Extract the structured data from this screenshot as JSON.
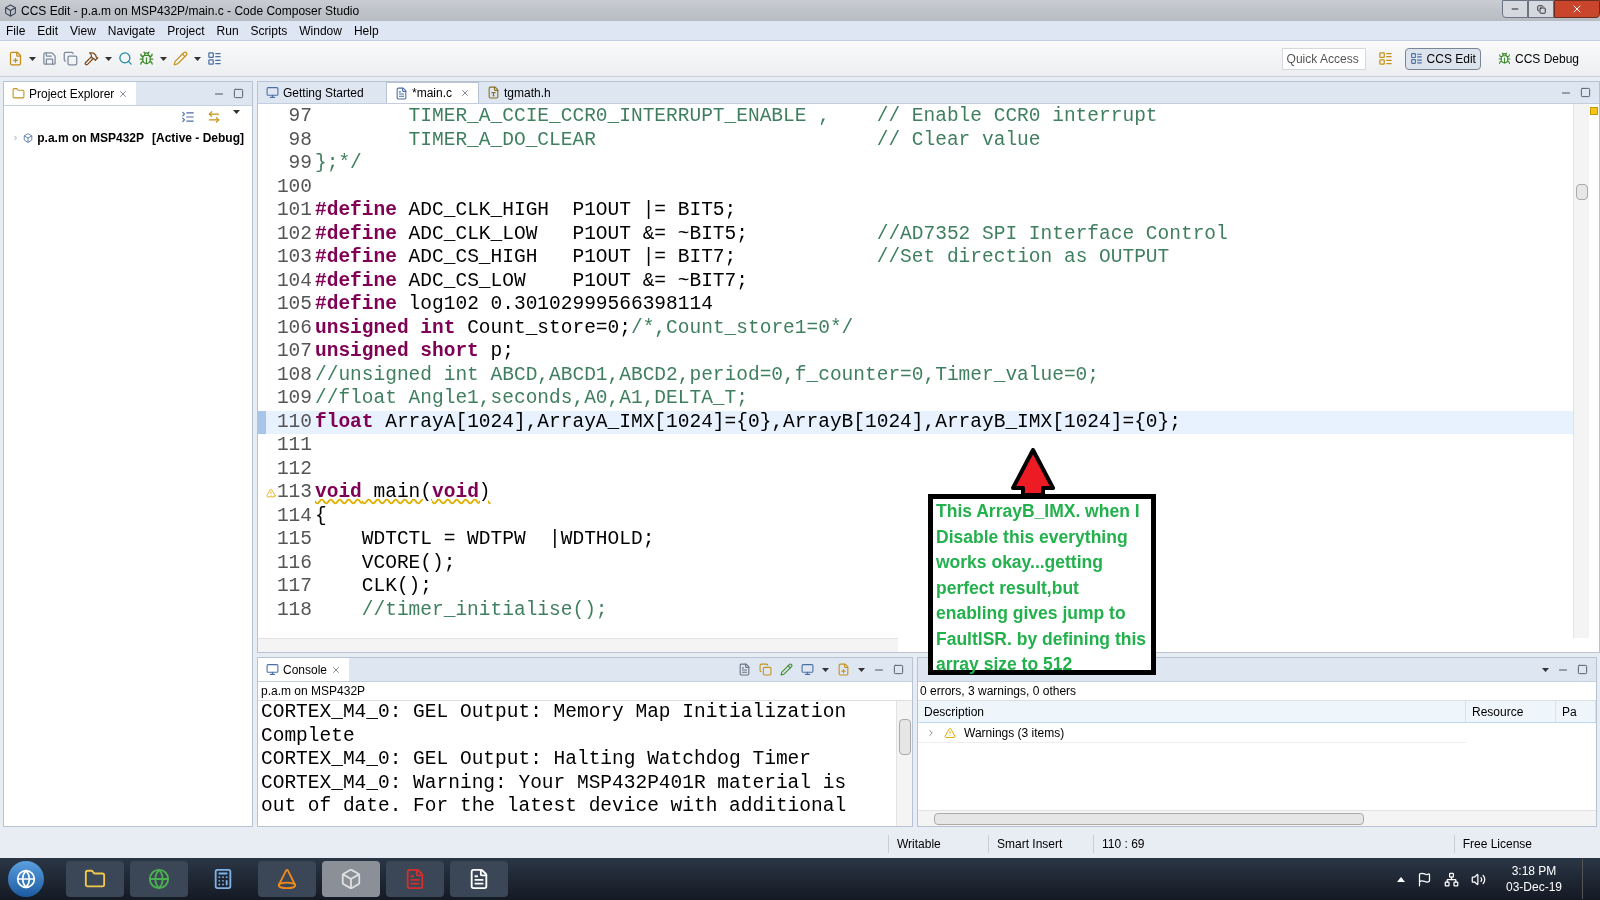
{
  "window": {
    "title": "CCS Edit - p.a.m on MSP432P/main.c - Code Composer Studio"
  },
  "menu": [
    "File",
    "Edit",
    "View",
    "Navigate",
    "Project",
    "Run",
    "Scripts",
    "Window",
    "Help"
  ],
  "toolbar": {
    "quick_access": {
      "placeholder": "Quick Access"
    },
    "perspectives": [
      {
        "label": "CCS Edit",
        "selected": true
      },
      {
        "label": "CCS Debug",
        "selected": false
      }
    ]
  },
  "project_explorer": {
    "title": "Project Explorer",
    "items": [
      {
        "label": "p.a.m on MSP432P",
        "status": "[Active - Debug]",
        "expanded": false
      }
    ]
  },
  "editor": {
    "tabs": [
      {
        "label": "Getting Started",
        "selected": false,
        "kind": "page"
      },
      {
        "label": "*main.c",
        "selected": true,
        "kind": "c"
      },
      {
        "label": "tgmath.h",
        "selected": false,
        "kind": "h"
      }
    ],
    "lines": [
      {
        "number": "97",
        "current": false,
        "warning": false,
        "tokens": [
          {
            "kind": "comment",
            "text": "        TIMER_A_CCIE_CCR0_INTERRUPT_ENABLE ,    // Enable CCR0 interrupt"
          }
        ]
      },
      {
        "number": "98",
        "current": false,
        "warning": false,
        "tokens": [
          {
            "kind": "comment",
            "text": "        TIMER_A_DO_CLEAR                        // Clear value"
          }
        ]
      },
      {
        "number": "99",
        "current": false,
        "warning": false,
        "tokens": [
          {
            "kind": "comment",
            "text": "};*/"
          }
        ]
      },
      {
        "number": "100",
        "current": false,
        "warning": false
      },
      {
        "number": "101",
        "current": false,
        "warning": false,
        "tokens": [
          {
            "kind": "keyword",
            "text": "#define"
          },
          {
            "kind": "plain",
            "text": " ADC_CLK_HIGH  P1OUT |= BIT5;"
          }
        ]
      },
      {
        "number": "102",
        "current": false,
        "warning": false,
        "tokens": [
          {
            "kind": "keyword",
            "text": "#define"
          },
          {
            "kind": "plain",
            "text": " ADC_CLK_LOW   P1OUT &= ~BIT5;           "
          },
          {
            "kind": "comment",
            "text": "//AD7352 SPI Interface Control"
          }
        ]
      },
      {
        "number": "103",
        "current": false,
        "warning": false,
        "tokens": [
          {
            "kind": "keyword",
            "text": "#define"
          },
          {
            "kind": "plain",
            "text": " ADC_CS_HIGH   P1OUT |= BIT7;            "
          },
          {
            "kind": "comment",
            "text": "//Set direction as OUTPUT"
          }
        ]
      },
      {
        "number": "104",
        "current": false,
        "warning": false,
        "tokens": [
          {
            "kind": "keyword",
            "text": "#define"
          },
          {
            "kind": "plain",
            "text": " ADC_CS_LOW    P1OUT &= ~BIT7;"
          }
        ]
      },
      {
        "number": "105",
        "current": false,
        "warning": false,
        "tokens": [
          {
            "kind": "keyword",
            "text": "#define"
          },
          {
            "kind": "plain",
            "text": " log102 0.30102999566398114"
          }
        ]
      },
      {
        "number": "106",
        "current": false,
        "warning": false,
        "tokens": [
          {
            "kind": "keyword",
            "text": "unsigned int"
          },
          {
            "kind": "plain",
            "text": " Count_store=0;"
          },
          {
            "kind": "comment",
            "text": "/*,Count_store1=0*/"
          }
        ]
      },
      {
        "number": "107",
        "current": false,
        "warning": false,
        "tokens": [
          {
            "kind": "keyword",
            "text": "unsigned short"
          },
          {
            "kind": "plain",
            "text": " p;"
          }
        ]
      },
      {
        "number": "108",
        "current": false,
        "warning": false,
        "tokens": [
          {
            "kind": "comment",
            "text": "//unsigned int ABCD,ABCD1,ABCD2,period=0,f_counter=0,Timer_value=0;"
          }
        ]
      },
      {
        "number": "109",
        "current": false,
        "warning": false,
        "tokens": [
          {
            "kind": "comment",
            "text": "//float Angle1,seconds,A0,A1,DELTA_T;"
          }
        ]
      },
      {
        "number": "110",
        "current": true,
        "warning": false,
        "tokens": [
          {
            "kind": "keyword",
            "text": "float"
          },
          {
            "kind": "plain",
            "text": " ArrayA[1024],ArrayA_IMX[1024]={0},ArrayB[1024],ArrayB_IMX[1024]={0};"
          }
        ]
      },
      {
        "number": "111",
        "current": false,
        "warning": false
      },
      {
        "number": "112",
        "current": false,
        "warning": false
      },
      {
        "number": "113",
        "current": false,
        "warning": true,
        "tokens": [
          {
            "kind": "keyword",
            "text": "void"
          },
          {
            "kind": "plain",
            "text": " main("
          },
          {
            "kind": "keyword",
            "text": "void"
          },
          {
            "kind": "plain",
            "text": ")"
          }
        ]
      },
      {
        "number": "114",
        "current": false,
        "warning": false,
        "tokens": [
          {
            "kind": "plain",
            "text": "{"
          }
        ]
      },
      {
        "number": "115",
        "current": false,
        "warning": false,
        "tokens": [
          {
            "kind": "plain",
            "text": "    WDTCTL = WDTPW  |WDTHOLD;"
          }
        ]
      },
      {
        "number": "116",
        "current": false,
        "warning": false,
        "tokens": [
          {
            "kind": "plain",
            "text": "    VCORE();"
          }
        ]
      },
      {
        "number": "117",
        "current": false,
        "warning": false,
        "tokens": [
          {
            "kind": "plain",
            "text": "    CLK();"
          }
        ]
      },
      {
        "number": "118",
        "current": false,
        "warning": false,
        "tokens": [
          {
            "kind": "comment",
            "text": "    //timer_initialise();"
          }
        ]
      }
    ]
  },
  "annotation": {
    "text": "This ArrayB_IMX. when I Disable this everything works okay...getting perfect result,but enabling gives jump to FaultISR. by defining this array size to 512"
  },
  "console": {
    "title": "Console",
    "source": "p.a.m on MSP432P",
    "lines": [
      "CORTEX_M4_0: GEL Output: Memory Map Initialization Complete",
      "CORTEX_M4_0: GEL Output: Halting Watchdog Timer",
      "CORTEX_M4_0: Warning: Your MSP432P401R material is out of date. For the latest device with additional"
    ]
  },
  "problems": {
    "summary": "0 errors, 3 warnings, 0 others",
    "columns": [
      "Description",
      "Resource",
      "Pa"
    ],
    "rows": [
      {
        "label": "Warnings (3 items)",
        "expanded": false
      }
    ]
  },
  "status_bar": [
    "Writable",
    "Smart Insert",
    "110 : 69",
    "Free License"
  ],
  "taskbar": {
    "time": "3:18 PM",
    "date": "03-Dec-19"
  }
}
